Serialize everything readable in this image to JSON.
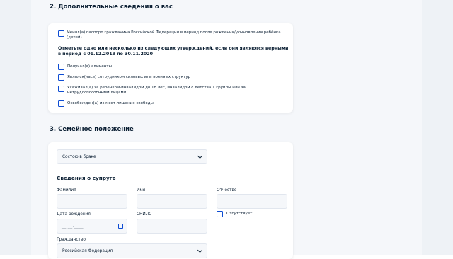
{
  "section2": {
    "title": "2. Дополнительные сведения о вас",
    "passport_checkbox": "Менял(а) паспорт гражданина Российской Федерации в период после рождения/усыновления ребёнка (детей)",
    "instruction": "Отметьте одно или несколько из следующих утверждений, если они являются верными в период с 01.12.2019 по 30.11.2020",
    "options": [
      {
        "label": "Получал(а) алименты",
        "checked": false
      },
      {
        "label": "Являлся(лась) сотрудником силовых или военных структур",
        "checked": false
      },
      {
        "label": "Ухаживал(а) за ребёнком-инвалидом до 18 лет, инвалидом с детства 1 группы или за нетрудоспособными лицами",
        "checked": false
      },
      {
        "label": "Освобожден(а) из мест лишения свободы",
        "checked": false
      }
    ]
  },
  "section3": {
    "title": "3. Семейное положение",
    "marital_status": "Состою в браке",
    "spouse_heading": "Сведения о супруге",
    "labels": {
      "surname": "Фамилия",
      "name": "Имя",
      "patronymic": "Отчество",
      "birth_date": "Дата рождения",
      "snils": "СНИЛС",
      "absent": "Отсутствует",
      "citizenship": "Гражданство"
    },
    "birth_date_placeholder": "__.__.____",
    "citizenship_value": "Российская Федерация"
  },
  "colors": {
    "accent": "#0d4cd3",
    "text": "#0b1f33",
    "page_bg": "#f5f7fa"
  }
}
